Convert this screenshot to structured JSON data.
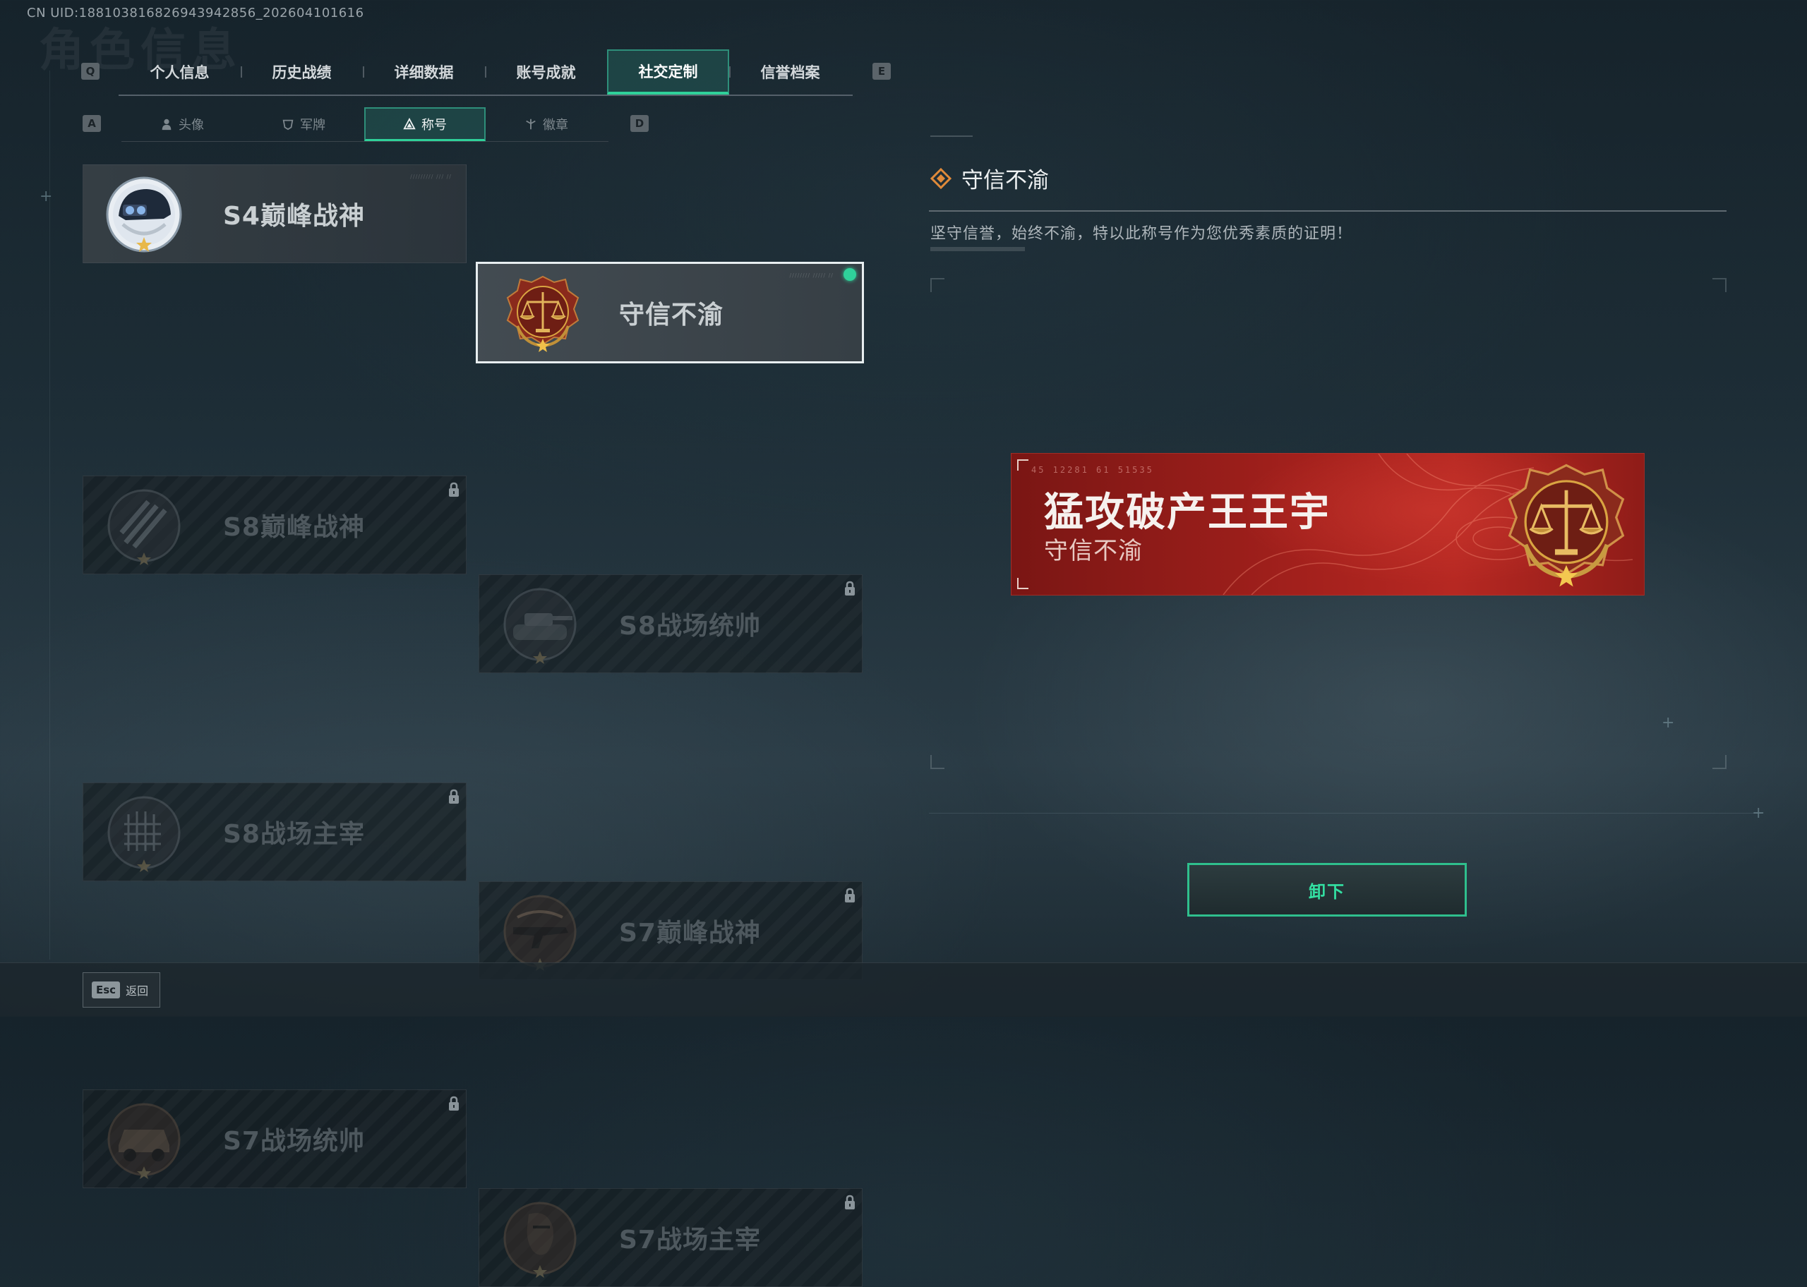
{
  "uid_text": "CN UID:188103816826943942856_202604101616",
  "ghost_title": "角色信息",
  "tabs_nav": {
    "left_key": "Q",
    "right_key": "E",
    "items": [
      {
        "label": "个人信息"
      },
      {
        "label": "历史战绩"
      },
      {
        "label": "详细数据"
      },
      {
        "label": "账号成就"
      },
      {
        "label": "社交定制",
        "active": true
      },
      {
        "label": "信誉档案"
      }
    ]
  },
  "subtabs_nav": {
    "left_key": "A",
    "right_key": "D",
    "items": [
      {
        "label": "头像",
        "icon": "person-icon"
      },
      {
        "label": "军牌",
        "icon": "dogtag-icon"
      },
      {
        "label": "称号",
        "icon": "title-icon",
        "active": true
      },
      {
        "label": "徽章",
        "icon": "badge-icon"
      }
    ]
  },
  "titles": [
    {
      "label": "S4巅峰战神",
      "state": "unlocked",
      "emblem": "helmet-emblem-icon"
    },
    {
      "label": "守信不渝",
      "state": "selected",
      "emblem": "scales-emblem-icon"
    },
    {
      "label": "S8巅峰战神",
      "state": "locked",
      "emblem": "stripes-emblem-icon"
    },
    {
      "label": "S8战场统帅",
      "state": "locked",
      "emblem": "tank-emblem-icon"
    },
    {
      "label": "S8战场主宰",
      "state": "locked",
      "emblem": "rocket-emblem-icon"
    },
    {
      "label": "S7巅峰战神",
      "state": "locked",
      "emblem": "rifle-emblem-icon"
    },
    {
      "label": "S7战场统帅",
      "state": "locked",
      "emblem": "vehicle-emblem-icon"
    },
    {
      "label": "S7战场主宰",
      "state": "locked",
      "emblem": "soldier-emblem-icon"
    }
  ],
  "detail": {
    "title": "守信不渝",
    "description": "坚守信誉，始终不渝，特以此称号作为您优秀素质的证明！"
  },
  "banner": {
    "player_name": "猛攻破产王王宇",
    "title": "守信不渝",
    "codes": "45 12281   61 51535"
  },
  "action_button": "卸下",
  "footer": {
    "esc_key": "Esc",
    "back_label": "返回"
  },
  "colors": {
    "accent": "#2fd19a",
    "banner_red": "#a2201c",
    "gold": "#d9a441"
  }
}
